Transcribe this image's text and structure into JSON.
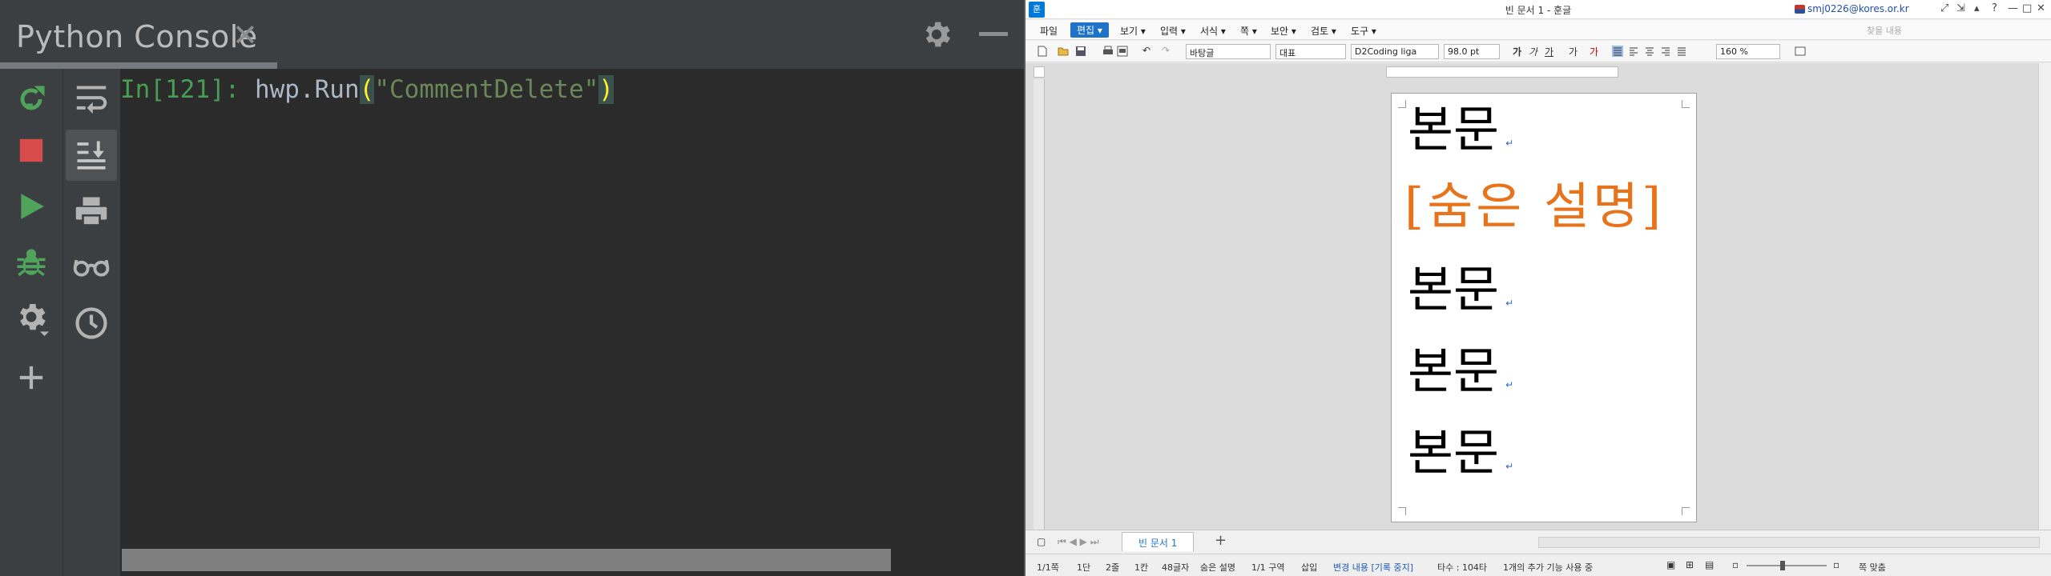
{
  "console": {
    "title": "Python Console",
    "close_glyph": "✕",
    "toolbar_a": [
      {
        "name": "rerun-icon",
        "color": "#4fa35a"
      },
      {
        "name": "stop-icon",
        "color": "#d74b4b"
      },
      {
        "name": "run-icon",
        "color": "#4fa35a"
      },
      {
        "name": "debug-icon",
        "color": "#4fa35a"
      },
      {
        "name": "settings-icon",
        "color": "#b3b3b3"
      },
      {
        "name": "add-icon",
        "color": "#b3b3b3"
      }
    ],
    "toolbar_b": [
      {
        "name": "soft-wrap-icon"
      },
      {
        "name": "scroll-to-end-icon"
      },
      {
        "name": "print-icon"
      },
      {
        "name": "show-variables-icon"
      },
      {
        "name": "history-icon"
      }
    ],
    "prompt": "In[121]:",
    "command_object": "hwp.Run",
    "open_paren": "(",
    "command_string": "\"CommentDelete\"",
    "close_paren": ")"
  },
  "hwp": {
    "title": "빈 문서 1 - 훈글",
    "user": "smj0226@kores.or.kr",
    "menu": [
      {
        "label": "파일",
        "active": false
      },
      {
        "label": "편집 ▾",
        "active": true
      },
      {
        "label": "보기 ▾",
        "active": false
      },
      {
        "label": "입력 ▾",
        "active": false
      },
      {
        "label": "서식 ▾",
        "active": false
      },
      {
        "label": "쪽 ▾",
        "active": false
      },
      {
        "label": "보안 ▾",
        "active": false
      },
      {
        "label": "검토 ▾",
        "active": false
      },
      {
        "label": "도구 ▾",
        "active": false
      }
    ],
    "search_placeholder": "찾을 내용",
    "toolbar": {
      "style_font": "바탕글",
      "style": "대표",
      "font_name": "D2Coding liga",
      "font_size": "98.0",
      "font_unit": "pt",
      "zoom": "160",
      "zoom_unit": "%"
    },
    "document": {
      "line1": "본문",
      "comment": "[숨은 설명]",
      "line3": "본문",
      "line4": "본문",
      "line5": "본문",
      "para_mark": "↵"
    },
    "tab_name": "빈 문서 1",
    "add_tab": "+",
    "status": {
      "page": "1/1쪽",
      "column": "1단",
      "line": "2줄",
      "col": "1칸",
      "chars": "48글자",
      "object": "숨은 설명",
      "section": "1/1 구역",
      "mode": "삽입",
      "track": "변경 내용 [기록 중지]",
      "typing": "타수 : 104타",
      "note": "1개의 추가 기능 사용 중",
      "fit": "쪽 맞춤"
    }
  }
}
